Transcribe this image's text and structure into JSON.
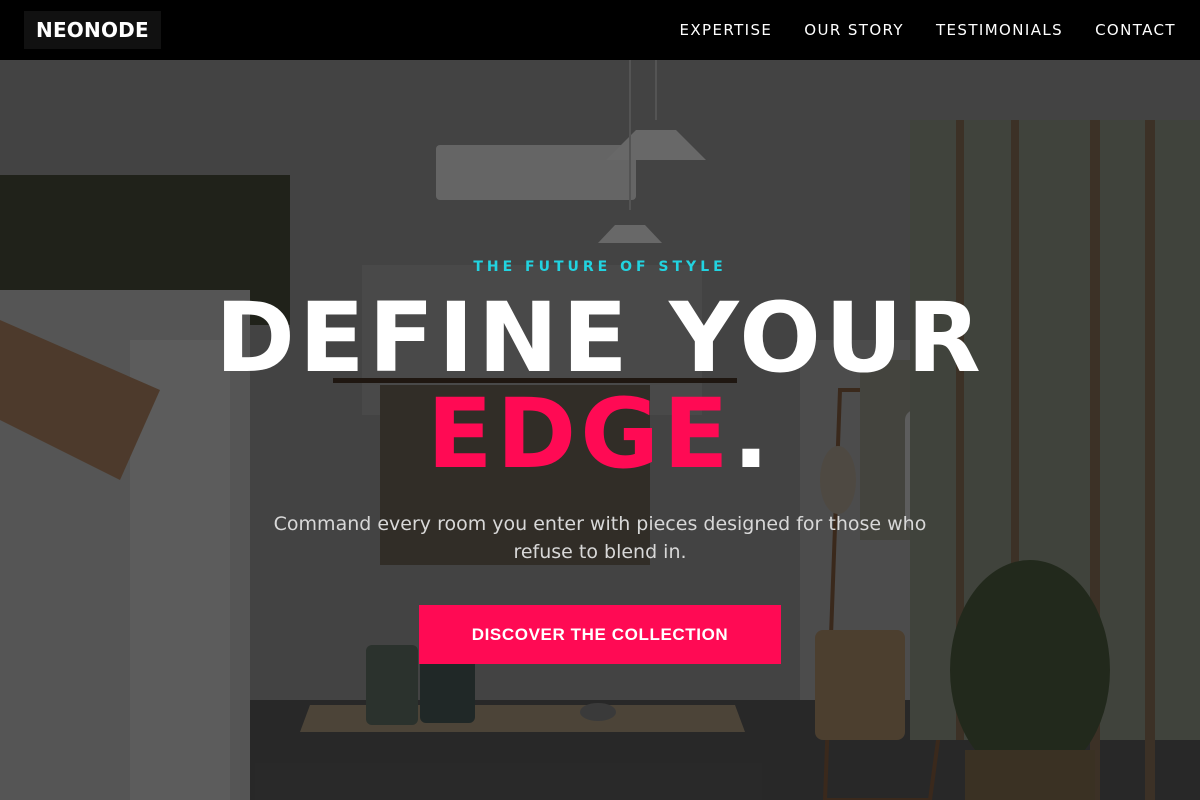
{
  "nav": {
    "brand": "NEONODE",
    "items": [
      {
        "label": "EXPERTISE"
      },
      {
        "label": "OUR STORY"
      },
      {
        "label": "TESTIMONIALS"
      },
      {
        "label": "CONTACT"
      }
    ]
  },
  "hero": {
    "eyebrow": "THE FUTURE OF STYLE",
    "headline_line1": "DEFINE YOUR",
    "headline_accent": "EDGE",
    "headline_period": ".",
    "subtitle": "Command every room you enter with pieces designed for those who refuse to blend in.",
    "cta_label": "DISCOVER THE COLLECTION"
  },
  "colors": {
    "accent": "#ff0a54",
    "eyebrow": "#22d3e0",
    "nav_background": "#000000"
  }
}
